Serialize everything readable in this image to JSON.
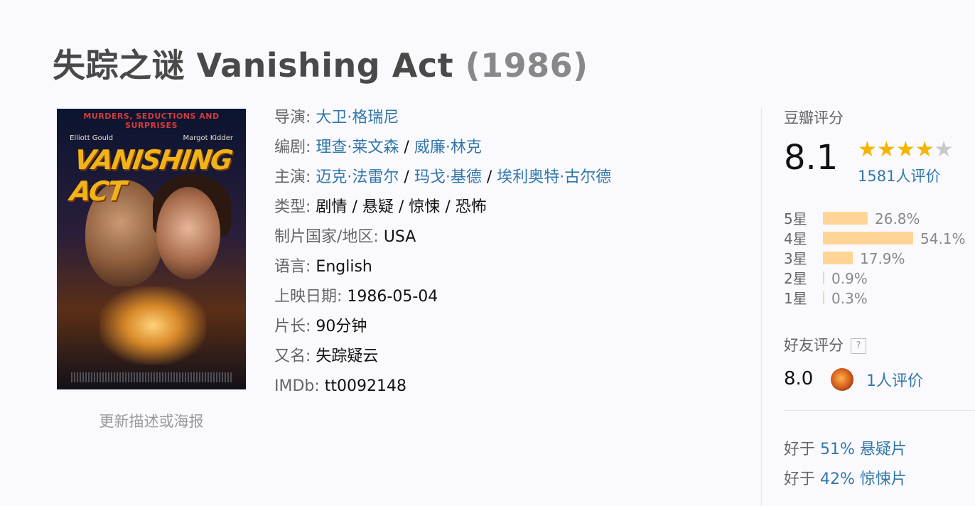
{
  "title": {
    "chinese": "失踪之谜",
    "english": "Vanishing Act",
    "year": "(1986)"
  },
  "poster": {
    "top_text": "MURDERS, SEDUCTIONS AND SURPRISES",
    "actor_left": "Elliott Gould",
    "actor_right": "Margot Kidder",
    "logo_text": "VANISHING ACT"
  },
  "update_link": "更新描述或海报",
  "info": {
    "director_label": "导演:",
    "director": [
      "大卫·格瑞尼"
    ],
    "writer_label": "编剧:",
    "writers": [
      "理查·莱文森",
      "威廉·林克"
    ],
    "cast_label": "主演:",
    "cast": [
      "迈克·法雷尔",
      "玛戈·基德",
      "埃利奥特·古尔德"
    ],
    "genre_label": "类型:",
    "genres": [
      "剧情",
      "悬疑",
      "惊悚",
      "恐怖"
    ],
    "country_label": "制片国家/地区:",
    "country": "USA",
    "language_label": "语言:",
    "language": "English",
    "release_label": "上映日期:",
    "release": "1986-05-04",
    "runtime_label": "片长:",
    "runtime": "90分钟",
    "aka_label": "又名:",
    "aka": "失踪疑云",
    "imdb_label": "IMDb:",
    "imdb": "tt0092148",
    "separator": "/"
  },
  "rating": {
    "header": "豆瓣评分",
    "score": "8.1",
    "stars_filled": 4,
    "stars_total": 5,
    "count": "1581人评价",
    "distribution": [
      {
        "label": "5星",
        "percent": "26.8%",
        "value": 26.8
      },
      {
        "label": "4星",
        "percent": "54.1%",
        "value": 54.1
      },
      {
        "label": "3星",
        "percent": "17.9%",
        "value": 17.9
      },
      {
        "label": "2星",
        "percent": "0.9%",
        "value": 0.9
      },
      {
        "label": "1星",
        "percent": "0.3%",
        "value": 0.3
      }
    ]
  },
  "friends": {
    "header": "好友评分",
    "help": "?",
    "score": "8.0",
    "count": "1人评价"
  },
  "better_than": [
    {
      "prefix": "好于",
      "percent": "51%",
      "genre": "悬疑片"
    },
    {
      "prefix": "好于",
      "percent": "42%",
      "genre": "惊悚片"
    }
  ],
  "colors": {
    "link": "#3377aa",
    "star": "#f5b400",
    "bar": "#ffd596"
  }
}
